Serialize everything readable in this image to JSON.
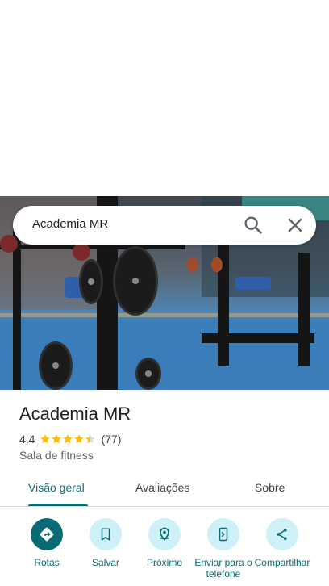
{
  "search": {
    "query": "Academia MR"
  },
  "place": {
    "name": "Academia MR",
    "rating": "4,4",
    "rating_value": 4.4,
    "reviews_count": "(77)",
    "category": "Sala de fitness"
  },
  "tabs": [
    {
      "label": "Visão geral",
      "active": true
    },
    {
      "label": "Avaliações",
      "active": false
    },
    {
      "label": "Sobre",
      "active": false
    }
  ],
  "actions": [
    {
      "label": "Rotas",
      "icon": "directions-icon"
    },
    {
      "label": "Salvar",
      "icon": "bookmark-icon"
    },
    {
      "label": "Próximo",
      "icon": "nearby-icon"
    },
    {
      "label": "Enviar para o\ntelefone",
      "icon": "send-to-phone-icon"
    },
    {
      "label": "Compartilhar",
      "icon": "share-icon"
    }
  ],
  "colors": {
    "accent": "#0b6b74",
    "action_bg": "#cdf1f6",
    "star": "#fbbc04"
  }
}
